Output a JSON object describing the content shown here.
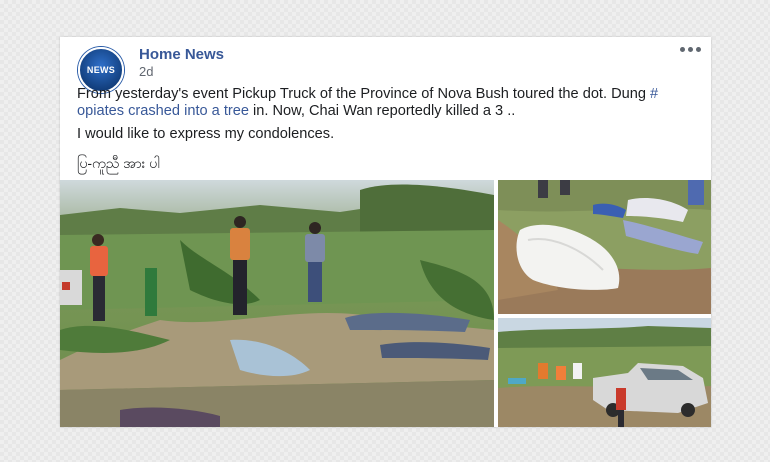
{
  "post": {
    "page_name": "Home News",
    "avatar_text": "NEWS",
    "timestamp": "2d",
    "text_before_hashtag": "From yesterday's event Pickup Truck of the Province of Nova Bush toured the dot. Dung ",
    "hashtag": "# opiates crashed into a tree",
    "text_after_hashtag": " in. Now, Chai Wan reportedly killed a 3 ..",
    "line2": "I would like to express my condolences.",
    "burmese": "ပြ-ကူညီ အား ပါ",
    "more_icon": "more-options-icon"
  },
  "colors": {
    "link": "#385898",
    "text": "#1c1e21",
    "meta": "#616770",
    "brand": "#13407f"
  },
  "photos": [
    {
      "name": "roadside-scene-photo"
    },
    {
      "name": "covered-bodies-photo"
    },
    {
      "name": "crashed-pickup-photo"
    }
  ]
}
